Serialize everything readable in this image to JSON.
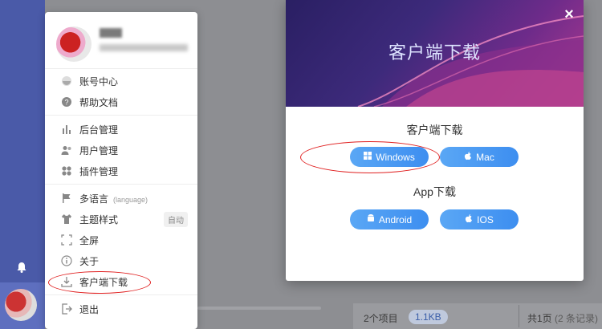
{
  "user_menu": {
    "items": [
      {
        "label": "账号中心",
        "icon": "user-center-icon"
      },
      {
        "label": "帮助文档",
        "icon": "help-icon"
      },
      {
        "label": "后台管理",
        "icon": "bar-chart-icon"
      },
      {
        "label": "用户管理",
        "icon": "users-icon"
      },
      {
        "label": "插件管理",
        "icon": "plugin-icon"
      },
      {
        "label": "多语言",
        "hint": "(language)",
        "icon": "flag-icon"
      },
      {
        "label": "主题样式",
        "badge": "自动",
        "icon": "shirt-icon"
      },
      {
        "label": "全屏",
        "icon": "fullscreen-icon"
      },
      {
        "label": "关于",
        "icon": "info-icon"
      },
      {
        "label": "客户端下载",
        "icon": "download-icon"
      },
      {
        "label": "退出",
        "icon": "logout-icon"
      }
    ]
  },
  "modal": {
    "banner_title": "客户端下载",
    "client_section": "客户端下载",
    "app_section": "App下载",
    "buttons": {
      "windows": "Windows",
      "mac": "Mac",
      "android": "Android",
      "ios": "IOS"
    }
  },
  "statusbar": {
    "items": "2个项目",
    "size": "1.1KB",
    "pages": "共1页",
    "records": "(2 条记录)"
  },
  "colors": {
    "rail": "#4a5aa8",
    "button": "#3d8ef0",
    "annotation": "#e02020"
  }
}
